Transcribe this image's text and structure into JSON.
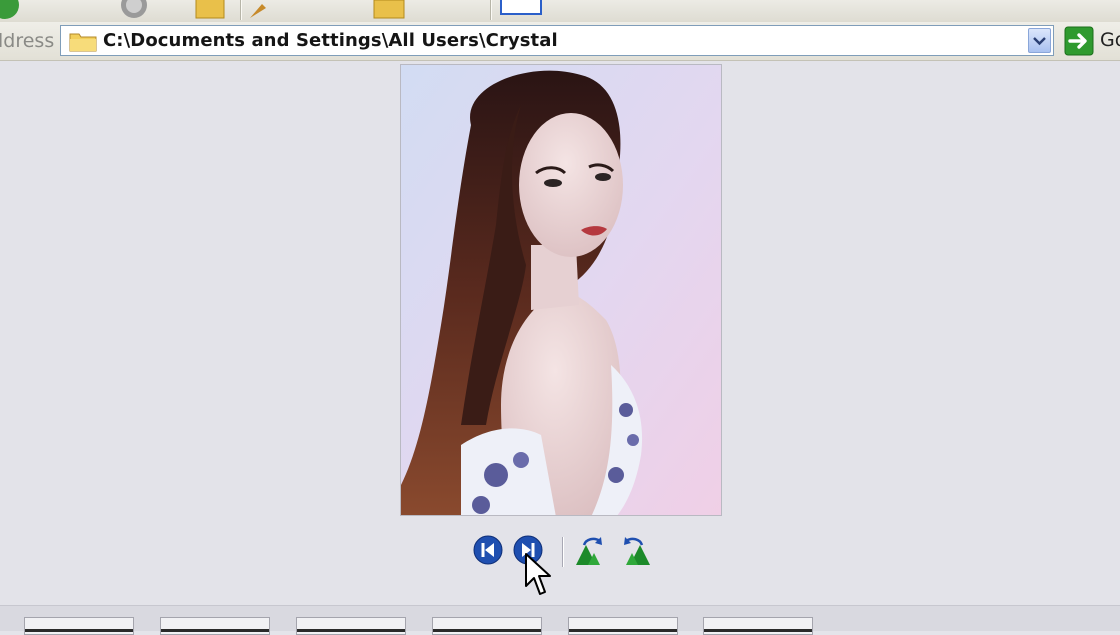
{
  "address_bar": {
    "label": "ldress",
    "path": "C:\\Documents and Settings\\All Users\\Crystal",
    "go_label": "Go"
  },
  "viewer": {
    "photo_alt": "Photo"
  },
  "controls": [
    {
      "name": "previous-image-button",
      "icon": "previous-icon"
    },
    {
      "name": "next-image-button",
      "icon": "next-icon"
    },
    {
      "name": "rotate-clockwise-button",
      "icon": "rotate-clockwise-icon"
    },
    {
      "name": "rotate-counterclockwise-button",
      "icon": "rotate-counterclockwise-icon"
    }
  ],
  "filmstrip": {
    "thumbnail_count": 6
  },
  "colors": {
    "accent_blue": "#1f4fb0",
    "go_green": "#2f9a2f",
    "rotate_green": "#1c8a2a"
  }
}
